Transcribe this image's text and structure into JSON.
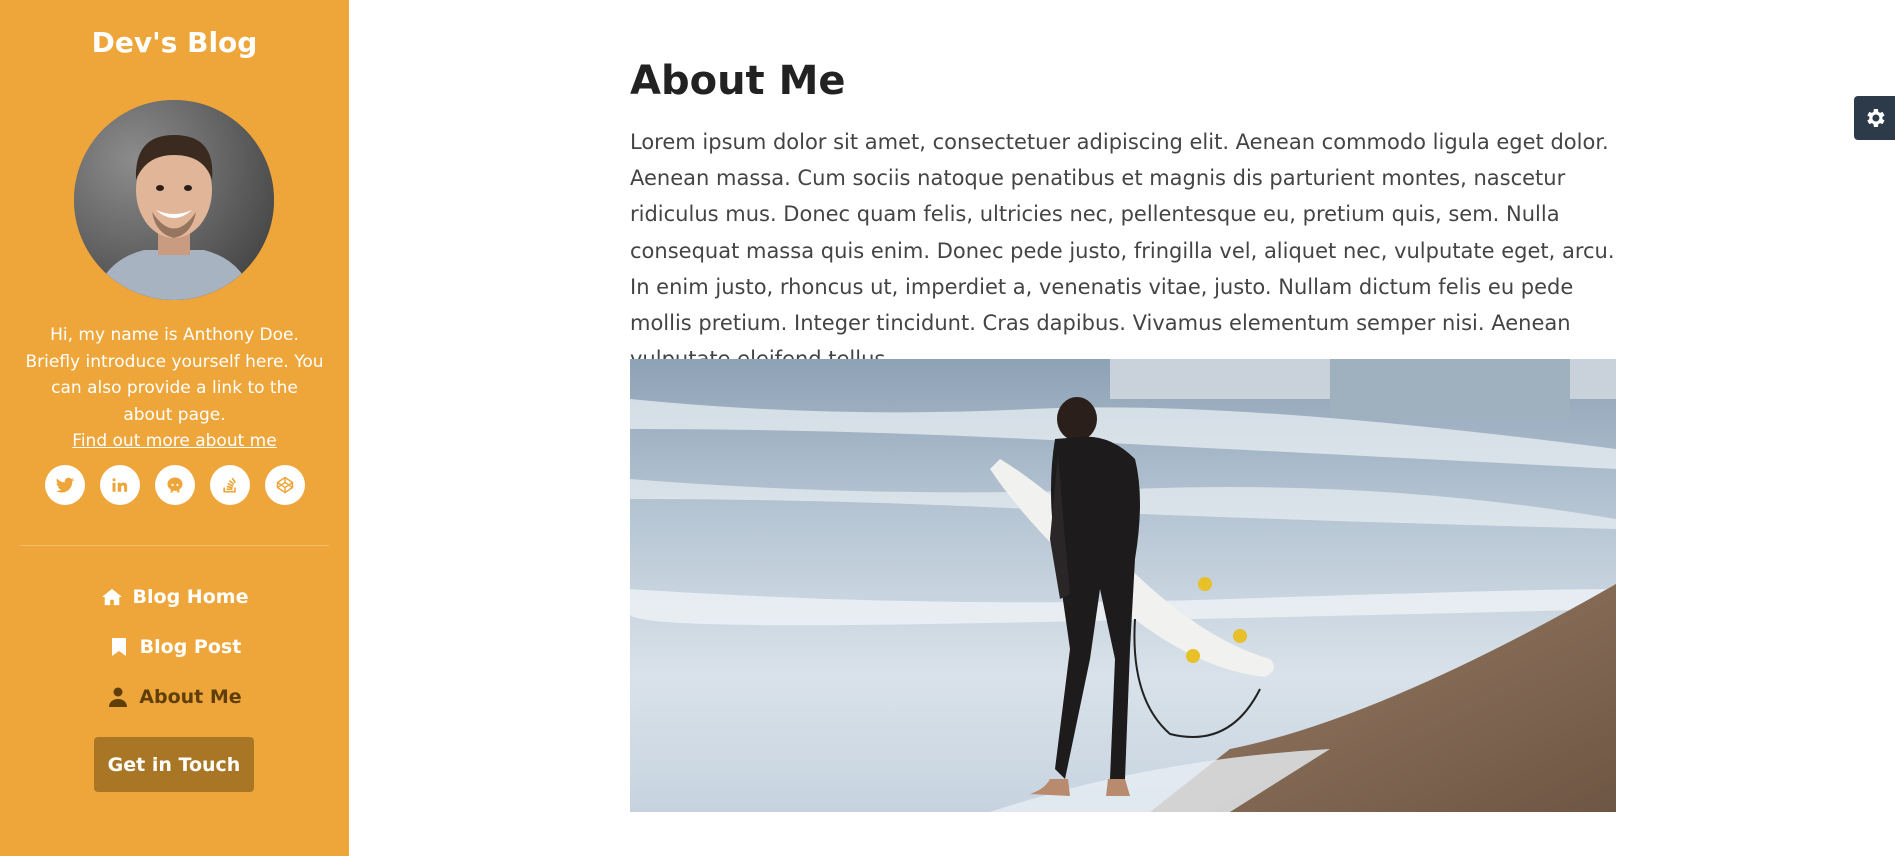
{
  "sidebar": {
    "blog_name": "Dev's Blog",
    "bio_text": "Hi, my name is Anthony Doe. Briefly introduce yourself here. You can also provide a link to the about page.",
    "bio_link": "Find out more about me",
    "social": [
      {
        "icon": "twitter-icon"
      },
      {
        "icon": "linkedin-icon"
      },
      {
        "icon": "github-icon"
      },
      {
        "icon": "stack-overflow-icon"
      },
      {
        "icon": "codepen-icon"
      }
    ],
    "nav": [
      {
        "label": "Blog Home",
        "icon": "home-icon"
      },
      {
        "label": "Blog Post",
        "icon": "bookmark-icon"
      },
      {
        "label": "About Me",
        "icon": "user-icon",
        "active": true
      }
    ],
    "cta_label": "Get in Touch"
  },
  "main": {
    "title": "About Me",
    "body": "Lorem ipsum dolor sit amet, consectetuer adipiscing elit. Aenean commodo ligula eget dolor. Aenean massa. Cum sociis natoque penatibus et magnis dis parturient montes, nascetur ridiculus mus. Donec quam felis, ultricies nec, pellentesque eu, pretium quis, sem. Nulla consequat massa quis enim. Donec pede justo, fringilla vel, aliquet nec, vulputate eget, arcu. In enim justo, rhoncus ut, imperdiet a, venenatis vitae, justo. Nullam dictum felis eu pede mollis pretium. Integer tincidunt. Cras dapibus. Vivamus elementum semper nisi. Aenean vulputate eleifend tellus."
  },
  "settings": {
    "icon": "gear-icon"
  },
  "colors": {
    "sidebar_bg": "#eea63a",
    "cta_bg": "#a87624",
    "active_nav": "#5f3e08",
    "settings_bg": "#2d3a4a"
  }
}
